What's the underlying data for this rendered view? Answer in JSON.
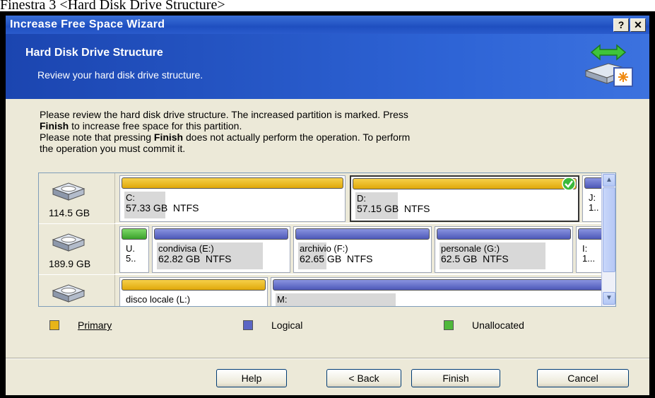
{
  "caption": "Finestra 3 <Hard Disk Drive Structure>",
  "window": {
    "title": "Increase Free Space Wizard",
    "help_btn": "?",
    "close_btn": "✕"
  },
  "header": {
    "title": "Hard Disk Drive Structure",
    "subtitle": "Review your hard disk drive structure."
  },
  "intro": {
    "line1": "Please review the hard disk drive structure. The increased partition is marked. Press",
    "line2_bold": "Finish",
    "line2_rest": " to increase free space for this partition.",
    "line3_pre": "Please note that pressing ",
    "line3_bold": "Finish",
    "line3_rest": " does not actually perform the operation. To perform",
    "line4": "the operation you must commit it."
  },
  "disks": [
    {
      "size": "114.5 GB",
      "partitions": [
        {
          "type": "primary",
          "name": "C:",
          "info": "57.33 GB  NTFS",
          "used": 0.18
        },
        {
          "type": "primary",
          "name": "D:",
          "info": "57.15 GB  NTFS",
          "used": 0.2,
          "marked": true
        },
        {
          "type": "logical",
          "name": "J:",
          "info": "1.."
        }
      ]
    },
    {
      "size": "189.9 GB",
      "partitions": [
        {
          "type": "unallocated",
          "name": "U.",
          "info": "5.."
        },
        {
          "type": "logical",
          "name": "condivisa (E:)",
          "info": "62.82 GB  NTFS"
        },
        {
          "type": "logical",
          "name": "archivio (F:)",
          "info": "62.65 GB  NTFS"
        },
        {
          "type": "logical",
          "name": "personale (G:)",
          "info": "62.5 GB  NTFS"
        },
        {
          "type": "logical",
          "name": "I:",
          "info": "1..."
        }
      ]
    },
    {
      "size": "",
      "partitions": [
        {
          "type": "primary",
          "name": "disco locale (L:)",
          "info": ""
        },
        {
          "type": "logical",
          "name": "M:",
          "info": ""
        }
      ]
    }
  ],
  "legend": {
    "primary": "Primary",
    "logical": "Logical",
    "unallocated": "Unallocated"
  },
  "buttons": {
    "help": "Help",
    "back": "< Back",
    "finish": "Finish",
    "cancel": "Cancel"
  },
  "colors": {
    "primary": "#e8b418",
    "logical": "#5b66c4",
    "unallocated": "#4fb83a",
    "title_bar": "#2557c7"
  }
}
